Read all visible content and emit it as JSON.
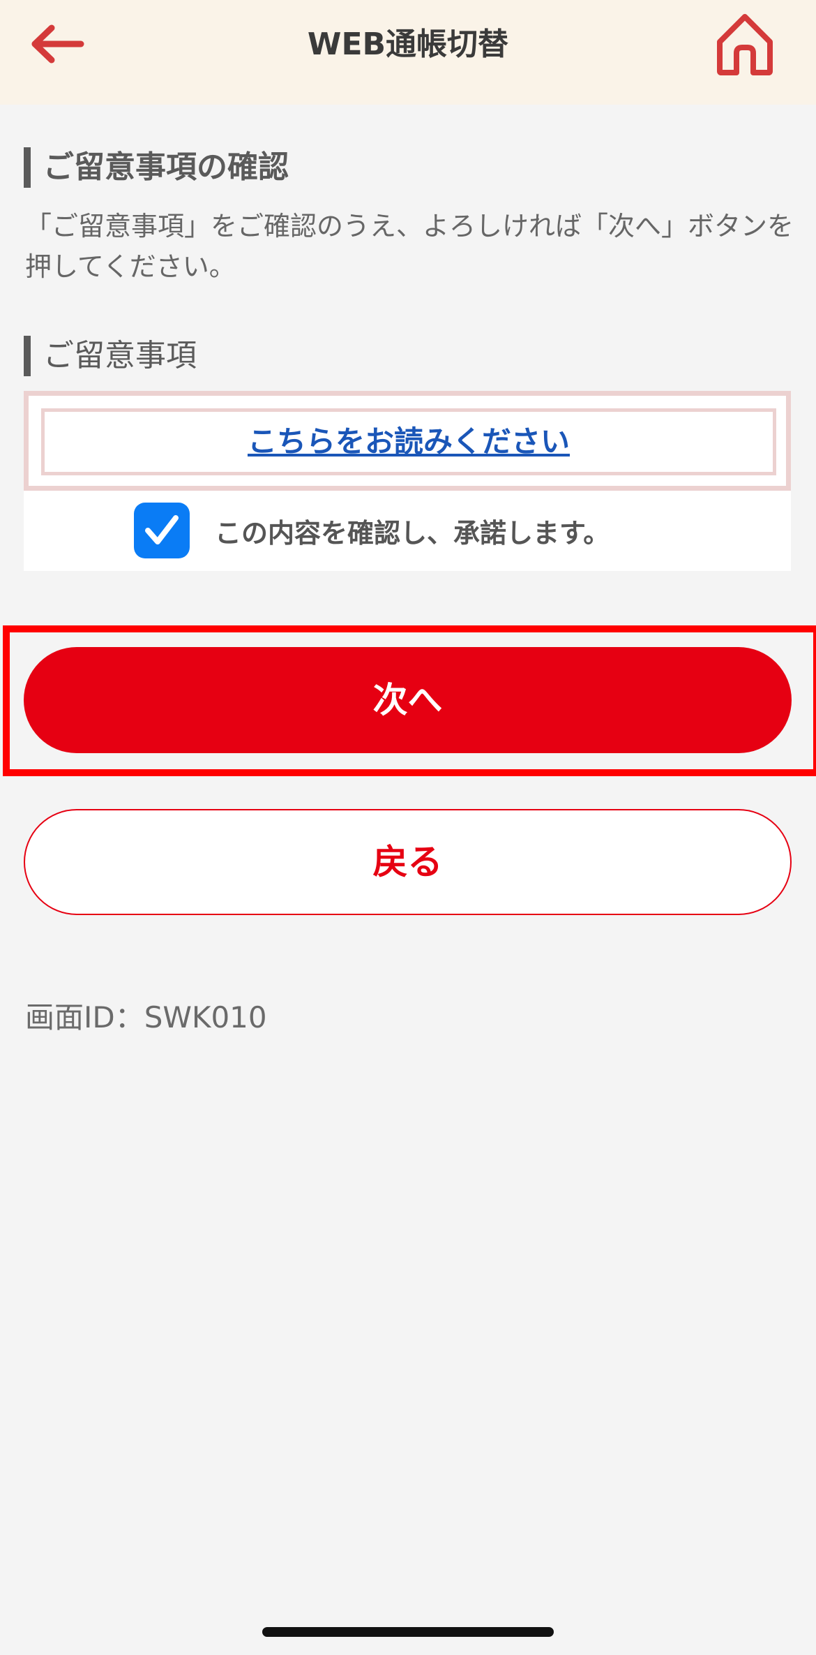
{
  "header": {
    "title": "WEB通帳切替",
    "back_icon": "arrow-left-icon",
    "home_icon": "home-icon",
    "accent_color": "#e60012"
  },
  "confirm_section": {
    "heading": "ご留意事項の確認",
    "description": "「ご留意事項」をご確認のうえ、よろしければ「次へ」ボタンを押してください。"
  },
  "notice_section": {
    "heading": "ご留意事項",
    "link_label": "こちらをお読みください",
    "agree_checked": true,
    "agree_label": "この内容を確認し、承諾します。"
  },
  "buttons": {
    "next_label": "次へ",
    "back_label": "戻る"
  },
  "footer": {
    "screen_id": "画面ID：SWK010"
  }
}
